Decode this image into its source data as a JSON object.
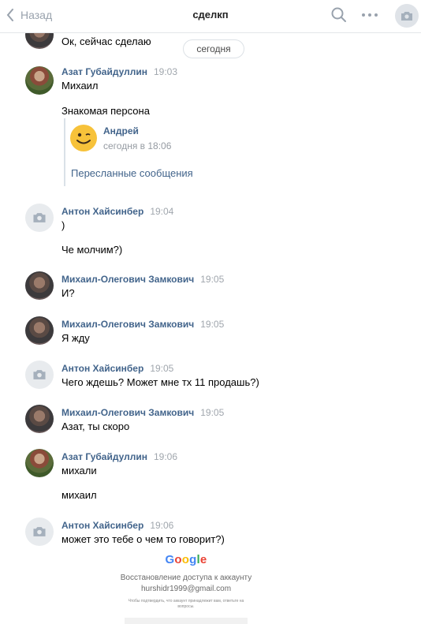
{
  "header": {
    "back_label": "Назад",
    "title": "сделкп"
  },
  "date_divider": "сегодня",
  "messages": [
    {
      "text": "Ок, сейчас сделаю"
    },
    {
      "author": "Азат Губайдуллин",
      "time": "19:03",
      "lines": [
        "Михаил",
        "Знакомая персона"
      ],
      "forward": {
        "author": "Андрей",
        "time": "сегодня в 18:06",
        "link": "Пересланные сообщения"
      }
    },
    {
      "author": "Антон Хайсинбер",
      "time": "19:04",
      "lines": [
        ")",
        "Че молчим?)"
      ]
    },
    {
      "author": "Михаил-Олегович Замкович",
      "time": "19:05",
      "lines": [
        "И?"
      ]
    },
    {
      "author": "Михаил-Олегович Замкович",
      "time": "19:05",
      "lines": [
        "Я жду"
      ]
    },
    {
      "author": "Антон Хайсинбер",
      "time": "19:05",
      "lines": [
        "Чего ждешь? Может мне тх 11 продашь?)"
      ]
    },
    {
      "author": "Михаил-Олегович Замкович",
      "time": "19:05",
      "lines": [
        "Азат, ты скоро"
      ]
    },
    {
      "author": "Азат Губайдуллин",
      "time": "19:06",
      "lines": [
        "михали",
        "михаил"
      ]
    },
    {
      "author": "Антон Хайсинбер",
      "time": "19:06",
      "lines": [
        "может это тебе о чем то говорит?)"
      ]
    }
  ],
  "attachment": {
    "logo": "Google",
    "line1": "Восстановление доступа к аккаунту",
    "line2": "hurshidr1999@gmail.com",
    "line3": "Чтобы подтвердить, что аккаунт принадлежит вам, ответьте на вопросы."
  },
  "colors": {
    "link": "#42648b",
    "muted": "#99a2ad",
    "smiley": "#f7c23a"
  }
}
